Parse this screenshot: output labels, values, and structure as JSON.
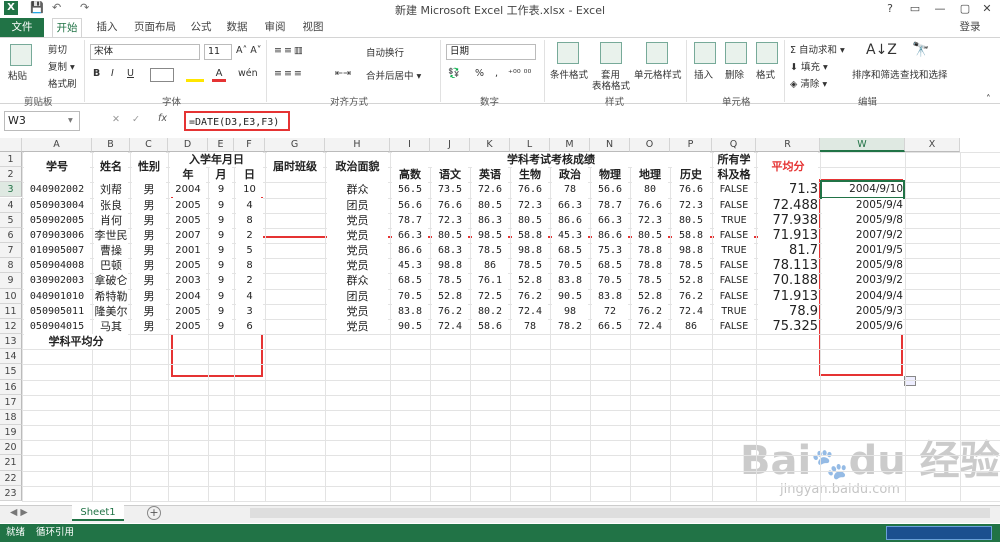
{
  "app": {
    "title": "新建 Microsoft Excel 工作表.xlsx - Excel",
    "login": "登录",
    "window_controls": [
      "?",
      "▭",
      "—",
      "▢",
      "✕"
    ]
  },
  "tabs": [
    "文件",
    "开始",
    "插入",
    "页面布局",
    "公式",
    "数据",
    "审阅",
    "视图"
  ],
  "ribbon": {
    "clipboard": {
      "paste": "粘贴",
      "cut": "剪切",
      "copy": "复制 ▾",
      "format_painter": "格式刷",
      "label": "剪贴板"
    },
    "font": {
      "name": "宋体",
      "size": "11",
      "label": "字体",
      "bold": "B",
      "italic": "I",
      "underline": "U"
    },
    "align": {
      "wrap": "自动换行",
      "merge": "合并后居中 ▾",
      "label": "对齐方式"
    },
    "number": {
      "format": "日期",
      "label": "数字",
      "percent": "%",
      "comma": ","
    },
    "styles": {
      "cond": "条件格式",
      "table1": "套用",
      "table2": "表格格式",
      "cell": "单元格样式",
      "label": "样式"
    },
    "cells": {
      "insert": "插入",
      "delete": "删除",
      "format": "格式",
      "label": "单元格"
    },
    "edit": {
      "autosum": "自动求和 ▾",
      "fill": "填充 ▾",
      "clear": "清除 ▾",
      "sort": "排序和筛选",
      "find": "查找和选择",
      "label": "编辑"
    }
  },
  "formula_bar": {
    "name_box": "W3",
    "formula": "=DATE(D3,E3,F3)",
    "fx": "fx"
  },
  "columns": [
    "A",
    "B",
    "C",
    "D",
    "E",
    "F",
    "G",
    "H",
    "I",
    "J",
    "K",
    "L",
    "M",
    "N",
    "O",
    "P",
    "Q",
    "R",
    "W",
    "X"
  ],
  "rows": [
    "1",
    "2",
    "3",
    "4",
    "5",
    "6",
    "7",
    "8",
    "9",
    "10",
    "11",
    "12",
    "13",
    "14",
    "15",
    "16",
    "17",
    "18",
    "19",
    "20",
    "21",
    "22",
    "23"
  ],
  "headers": {
    "id": "学号",
    "name": "姓名",
    "gender": "性别",
    "enroll": "入学年月日",
    "year": "年",
    "month": "月",
    "day": "日",
    "class": "届时班级",
    "politics": "政治面貌",
    "exam": "学科考试考核成绩",
    "subjects": [
      "高数",
      "语文",
      "英语",
      "生物",
      "政治",
      "物理",
      "地理",
      "历史"
    ],
    "pass1": "所有学",
    "pass2": "科及格",
    "avg": "平均分",
    "subject_avg": "学科平均分"
  },
  "records": [
    {
      "id": "040902002",
      "name": "刘帮",
      "g": "男",
      "y": "2004",
      "m": "9",
      "d": "10",
      "pol": "群众",
      "s": [
        "56.5",
        "73.5",
        "72.6",
        "76.6",
        "78",
        "56.6",
        "80",
        "76.6"
      ],
      "pass": "FALSE",
      "avg": "71.3",
      "date": "2004/9/10"
    },
    {
      "id": "050903004",
      "name": "张良",
      "g": "男",
      "y": "2005",
      "m": "9",
      "d": "4",
      "pol": "团员",
      "s": [
        "56.6",
        "76.6",
        "80.5",
        "72.3",
        "66.3",
        "78.7",
        "76.6",
        "72.3"
      ],
      "pass": "FALSE",
      "avg": "72.488",
      "date": "2005/9/4"
    },
    {
      "id": "050902005",
      "name": "肖何",
      "g": "男",
      "y": "2005",
      "m": "9",
      "d": "8",
      "pol": "党员",
      "s": [
        "78.7",
        "72.3",
        "86.3",
        "80.5",
        "86.6",
        "66.3",
        "72.3",
        "80.5"
      ],
      "pass": "TRUE",
      "avg": "77.938",
      "date": "2005/9/8"
    },
    {
      "id": "070903006",
      "name": "李世民",
      "g": "男",
      "y": "2007",
      "m": "9",
      "d": "2",
      "pol": "党员",
      "s": [
        "66.3",
        "80.5",
        "98.5",
        "58.8",
        "45.3",
        "86.6",
        "80.5",
        "58.8"
      ],
      "pass": "FALSE",
      "avg": "71.913",
      "date": "2007/9/2"
    },
    {
      "id": "010905007",
      "name": "曹操",
      "g": "男",
      "y": "2001",
      "m": "9",
      "d": "5",
      "pol": "党员",
      "s": [
        "86.6",
        "68.3",
        "78.5",
        "98.8",
        "68.5",
        "75.3",
        "78.8",
        "98.8"
      ],
      "pass": "TRUE",
      "avg": "81.7",
      "date": "2001/9/5"
    },
    {
      "id": "050904008",
      "name": "巴顿",
      "g": "男",
      "y": "2005",
      "m": "9",
      "d": "8",
      "pol": "党员",
      "s": [
        "45.3",
        "98.8",
        "86",
        "78.5",
        "70.5",
        "68.5",
        "78.8",
        "78.5"
      ],
      "pass": "FALSE",
      "avg": "78.113",
      "date": "2005/9/8"
    },
    {
      "id": "030902003",
      "name": "拿破仑",
      "g": "男",
      "y": "2003",
      "m": "9",
      "d": "2",
      "pol": "群众",
      "s": [
        "68.5",
        "78.5",
        "76.1",
        "52.8",
        "83.8",
        "70.5",
        "78.5",
        "52.8"
      ],
      "pass": "FALSE",
      "avg": "70.188",
      "date": "2003/9/2"
    },
    {
      "id": "040901010",
      "name": "希特勒",
      "g": "男",
      "y": "2004",
      "m": "9",
      "d": "4",
      "pol": "团员",
      "s": [
        "70.5",
        "52.8",
        "72.5",
        "76.2",
        "90.5",
        "83.8",
        "52.8",
        "76.2"
      ],
      "pass": "FALSE",
      "avg": "71.913",
      "date": "2004/9/4"
    },
    {
      "id": "050905011",
      "name": "隆美尔",
      "g": "男",
      "y": "2005",
      "m": "9",
      "d": "3",
      "pol": "党员",
      "s": [
        "83.8",
        "76.2",
        "80.2",
        "72.4",
        "98",
        "72",
        "76.2",
        "72.4"
      ],
      "pass": "TRUE",
      "avg": "78.9",
      "date": "2005/9/3"
    },
    {
      "id": "050904015",
      "name": "马其",
      "g": "男",
      "y": "2005",
      "m": "9",
      "d": "6",
      "pol": "党员",
      "s": [
        "90.5",
        "72.4",
        "58.6",
        "78",
        "78.2",
        "66.5",
        "72.4",
        "86"
      ],
      "pass": "FALSE",
      "avg": "75.325",
      "date": "2005/9/6"
    }
  ],
  "sheet_tab": "Sheet1",
  "add_sheet": "+",
  "status": {
    "ready": "就绪",
    "circular": "循环引用"
  },
  "colors": {
    "accent": "#217346",
    "highlight": "#e53333"
  },
  "watermark": "Baidu经验 jingyan.baidu.com"
}
